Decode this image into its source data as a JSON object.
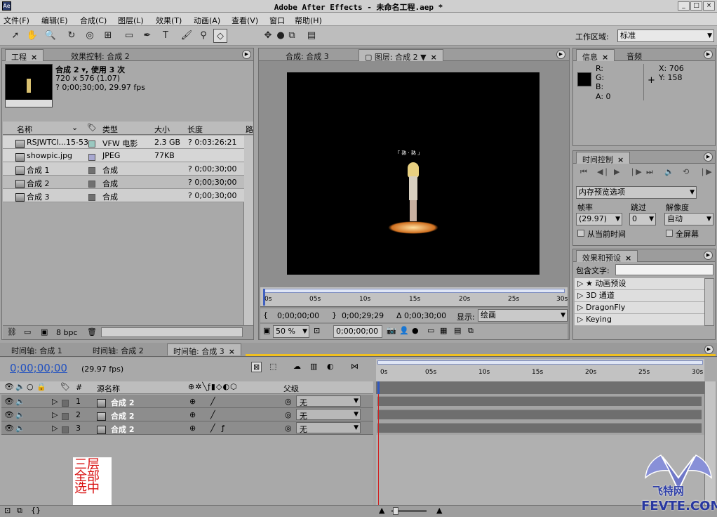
{
  "app": {
    "title": "Adobe After Effects - 未命名工程.aep *"
  },
  "menu": [
    "文件(F)",
    "编辑(E)",
    "合成(C)",
    "图层(L)",
    "效果(T)",
    "动画(A)",
    "查看(V)",
    "窗口",
    "帮助(H)"
  ],
  "workspace": {
    "label": "工作区域:",
    "value": "标准"
  },
  "project": {
    "tab_project": "工程",
    "tab_effects": "效果控制: 合成 2",
    "info_name": "合成 2 ▾, 使用 3 次",
    "info_size": "720 x 576 (1.07)",
    "info_dur": "? 0;00;30;00, 29.97 fps",
    "headers": {
      "name": "名称",
      "type": "类型",
      "size": "大小",
      "length": "长度",
      "path": "路"
    },
    "items": [
      {
        "name": "RSJWTCl...15-53",
        "type": "VFW 电影",
        "size": "2.3 GB",
        "length": "? 0:03:26:21",
        "color": "#9ac8c0"
      },
      {
        "name": "showpic.jpg",
        "type": "JPEG",
        "size": "77KB",
        "length": "",
        "color": "#a8a8d0"
      },
      {
        "name": "合成 1",
        "type": "合成",
        "size": "",
        "length": "? 0;00;30;00",
        "color": "#707070"
      },
      {
        "name": "合成 2",
        "type": "合成",
        "size": "",
        "length": "? 0;00;30;00",
        "color": "#707070"
      },
      {
        "name": "合成 3",
        "type": "合成",
        "size": "",
        "length": "? 0;00;30;00",
        "color": "#707070"
      }
    ],
    "bpc": "8 bpc"
  },
  "comp": {
    "tab_comp": "合成: 合成 3",
    "tab_layer": "图层: 合成 2",
    "ruler": [
      "0s",
      "05s",
      "10s",
      "15s",
      "20s",
      "25s",
      "30s"
    ],
    "in_time": "0;00;00;00",
    "out_time": "0;00;29;29",
    "delta": "Δ 0;00;30;00",
    "show_label": "显示:",
    "show_value": "绘画",
    "zoom": "50 %",
    "cur_time": "0;00;00;00",
    "viewer_caption": "「 熟 · 熟 」"
  },
  "info": {
    "tab_info": "信息",
    "tab_audio": "音频",
    "R": "R:",
    "G": "G:",
    "B": "B:",
    "A": "A:  0",
    "X": "X:  706",
    "Y": "Y:  158"
  },
  "time_control": {
    "tab": "时间控制",
    "preview": "内存预览选项",
    "fps_label": "帧率",
    "skip_label": "跳过",
    "res_label": "解像度",
    "fps": "(29.97)",
    "skip": "0",
    "res": "自动",
    "from_current": "从当前时间",
    "fullscreen": "全屏幕"
  },
  "effects": {
    "tab": "效果和预设",
    "contains": "包含文字:",
    "items": [
      "★ 动画预设",
      "3D 通道",
      "DragonFly",
      "Keying"
    ]
  },
  "timeline": {
    "tabs": [
      "时间轴: 合成 1",
      "时间轴: 合成 2",
      "时间轴: 合成 3"
    ],
    "timecode": "0;00;00;00",
    "fps": "(29.97 fps)",
    "col_num": "#",
    "col_source": "源名称",
    "col_parent": "父级",
    "ruler": [
      "0s",
      "05s",
      "10s",
      "15s",
      "20s",
      "25s",
      "30s"
    ],
    "layers": [
      {
        "num": "1",
        "name": "合成 2",
        "parent": "无"
      },
      {
        "num": "2",
        "name": "合成 2",
        "parent": "无"
      },
      {
        "num": "3",
        "name": "合成 2",
        "parent": "无"
      }
    ],
    "note": "三层全部选中"
  },
  "watermark": {
    "cn": "飞特网",
    "en": "FEVTE.COM"
  }
}
